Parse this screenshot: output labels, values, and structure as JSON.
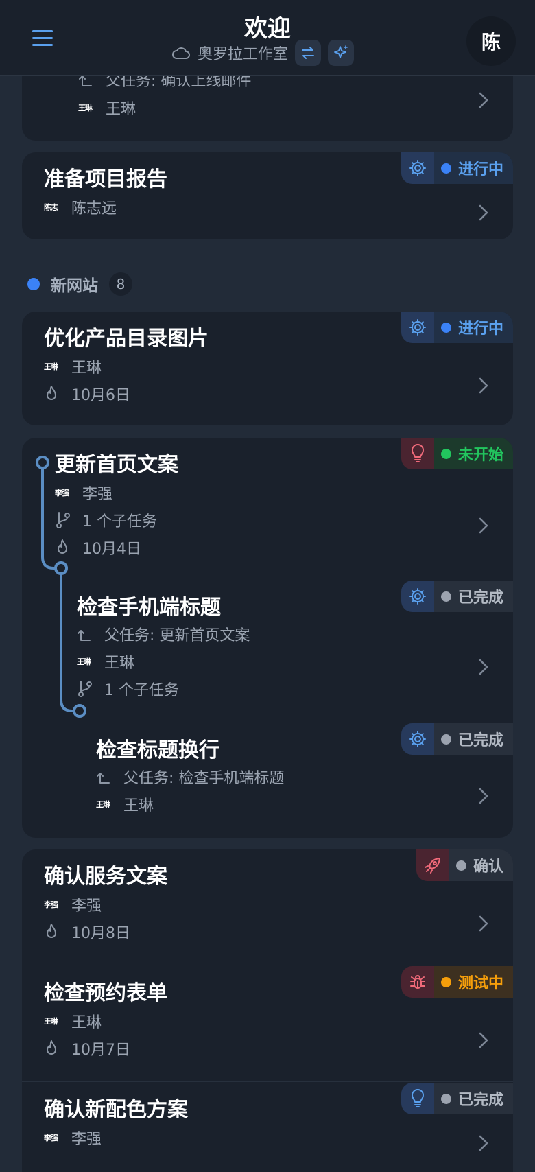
{
  "header": {
    "title": "欢迎",
    "workspace": "奥罗拉工作室",
    "avatar_initial": "陈"
  },
  "task_top": {
    "parent": "父任务: 确认上线邮件",
    "assignee": "王琳",
    "initials": "王琳"
  },
  "task_report": {
    "title": "准备项目报告",
    "assignee": "陈志远",
    "initials": "陈志",
    "status": "进行中"
  },
  "group": {
    "name": "新网站",
    "count": "8",
    "color": "#3b82f6"
  },
  "task_optimize": {
    "title": "优化产品目录图片",
    "assignee": "王琳",
    "initials": "王琳",
    "date": "10月6日",
    "status": "进行中"
  },
  "task_home": {
    "title": "更新首页文案",
    "assignee": "李强",
    "initials": "李强",
    "subtasks": "1 个子任务",
    "date": "10月4日",
    "status": "未开始"
  },
  "task_mobile": {
    "title": "检查手机端标题",
    "parent": "父任务: 更新首页文案",
    "assignee": "王琳",
    "initials": "王琳",
    "subtasks": "1 个子任务",
    "status": "已完成"
  },
  "task_wrap": {
    "title": "检查标题换行",
    "parent": "父任务: 检查手机端标题",
    "assignee": "王琳",
    "initials": "王琳",
    "status": "已完成"
  },
  "task_service": {
    "title": "确认服务文案",
    "assignee": "李强",
    "initials": "李强",
    "date": "10月8日",
    "status": "确认"
  },
  "task_form": {
    "title": "检查预约表单",
    "assignee": "王琳",
    "initials": "王琳",
    "date": "10月7日",
    "status": "测试中"
  },
  "task_color": {
    "title": "确认新配色方案",
    "assignee": "李强",
    "initials": "李强",
    "status": "已完成"
  },
  "colors": {
    "accent": "#5aa0ee",
    "in_progress": "#3b82f6",
    "not_started": "#22c55e",
    "done": "#9ca3af",
    "testing": "#f59e0b",
    "tree_line": "#5b8ec4"
  },
  "icons": [
    "menu-icon",
    "cloud-icon",
    "swap-icon",
    "sparkle-icon",
    "parent-arrow-icon",
    "branch-icon",
    "flame-icon",
    "gear-icon",
    "lightbulb-icon",
    "rocket-icon",
    "bug-icon",
    "chevron-right-icon"
  ]
}
